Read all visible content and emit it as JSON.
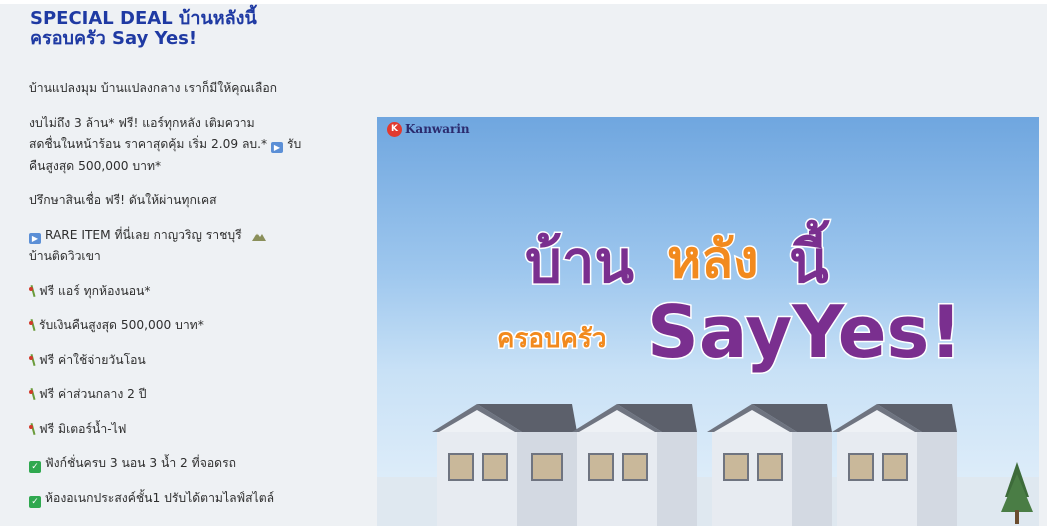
{
  "heading": {
    "line1": "SPECIAL DEAL บ้านหลังนี้",
    "line2": "ครอบครัว Say Yes!"
  },
  "copy": {
    "intro": "บ้านแปลงมุม บ้านแปลงกลาง เราก็มีให้คุณเลือก",
    "budget": {
      "line1": "งบไม่ถึง 3 ล้าน* ฟรี! แอร์ทุกหลัง  เติมความ",
      "line2_a": "สดชื่นในหน้าร้อน ราคาสุดคุ้ม เริ่ม 2.09 ลบ.*",
      "line2_b": "รับ",
      "line3": "คืนสูงสุด 500,000 บาท*"
    },
    "consult": "ปรึกษาสินเชื่อ ฟรี! ดันให้ผ่านทุกเคส",
    "rare": {
      "line1": "RARE ITEM ที่นี่เลย กาญวริญ ราชบุรี",
      "line2": "บ้านติดวิวเขา"
    },
    "perks": [
      "ฟรี แอร์ ทุกห้องนอน*",
      "รับเงินคืนสูงสุด 500,000 บาท*",
      "ฟรี ค่าใช้จ่ายวันโอน",
      "ฟรี ค่าส่วนกลาง 2 ปี",
      "ฟรี มิเตอร์น้ำ-ไฟ"
    ],
    "features": [
      "ฟังก์ชั่นครบ 3 นอน 3 น้ำ 2 ที่จอดรถ",
      "ห้องอเนกประสงค์ชั้น1 ปรับได้ตามไลฟ์สไตล์"
    ]
  },
  "banner": {
    "brand": "Kanwarin",
    "brand_initial": "K",
    "headline": {
      "word1": "บ้าน",
      "word2": "หลัง",
      "word3": "นี้",
      "word4": "ครอบครัว",
      "word5": "SayYes!"
    }
  },
  "colors": {
    "heading": "#1f3aa3",
    "headline_purple": "#7a2f8f",
    "headline_orange": "#f28a1e",
    "brand_red": "#e23a2f"
  },
  "icons": {
    "fast_forward": "fast-forward-icon",
    "check": "check-box-icon",
    "sprig": "sprig-icon",
    "mountain": "mountain-icon"
  }
}
